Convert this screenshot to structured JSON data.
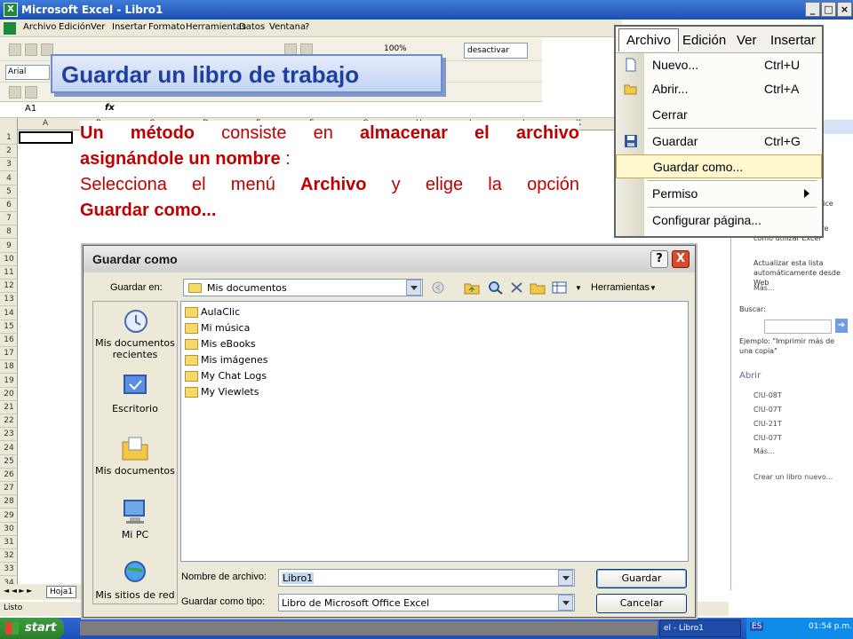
{
  "excel": {
    "title": "Microsoft Excel - Libro1",
    "menu": [
      "Archivo",
      "Edición",
      "Ver",
      "Insertar",
      "Formato",
      "Herramientas",
      "Datos",
      "Ventana",
      "?"
    ],
    "font_name": "Arial",
    "zoom": "100%",
    "desactivar": "desactivar",
    "cell_ref": "A1",
    "fx": "fx",
    "columns": [
      "A",
      "B",
      "C",
      "D",
      "E",
      "F",
      "G",
      "H",
      "I",
      "J",
      "K"
    ],
    "rows": [
      "1",
      "2",
      "3",
      "4",
      "5",
      "6",
      "7",
      "8",
      "9",
      "10",
      "11",
      "12",
      "13",
      "14",
      "15",
      "16",
      "17",
      "18",
      "19",
      "20",
      "21",
      "22",
      "23",
      "24",
      "25",
      "26",
      "27",
      "28",
      "29",
      "30",
      "31",
      "32",
      "33",
      "34"
    ],
    "sheet_tab": "Hoja1",
    "status": "Listo"
  },
  "task_pane": {
    "office_text": "ft Office",
    "help_item1": "n más reciente sobre cómo utilizar Excel",
    "help_item2": "Actualizar esta lista automáticamente desde Web",
    "mas1": "Más...",
    "search_label": "Buscar:",
    "example": "Ejemplo: \"Imprimir más de una copia\"",
    "abrir_heading": "Abrir",
    "recent_files": [
      "CIU-08T",
      "CIU-07T",
      "CIU-21T",
      "CIU-07T"
    ],
    "mas2": "Más...",
    "new_book": "Crear un libro nuevo..."
  },
  "slide": {
    "title": "Guardar un libro de trabajo",
    "line1": {
      "a": "Un método",
      "b": " consiste en ",
      "c": "almacenar el archivo"
    },
    "line2": {
      "a": "asignándole un nombre",
      "b": " :"
    },
    "line3": {
      "a": "Selecciona el menú ",
      "b": "Archivo",
      "c": " y elige la opción"
    },
    "line4": "Guardar como..."
  },
  "archivo_menu": {
    "menubar": [
      "Archivo",
      "Edición",
      "Ver",
      "Insertar"
    ],
    "items": [
      {
        "label": "Nuevo...",
        "shortcut": "Ctrl+U"
      },
      {
        "label": "Abrir...",
        "shortcut": "Ctrl+A"
      },
      {
        "label": "Cerrar",
        "shortcut": ""
      },
      {
        "label": "Guardar",
        "shortcut": "Ctrl+G"
      },
      {
        "label": "Guardar como...",
        "shortcut": "",
        "highlighted": true
      },
      {
        "label": "Permiso",
        "shortcut": ""
      },
      {
        "label": "Configurar página...",
        "shortcut": ""
      }
    ]
  },
  "dialog": {
    "title": "Guardar como",
    "help": "?",
    "close": "X",
    "save_in_label": "Guardar en:",
    "save_in_value": "Mis documentos",
    "tools_label": "Herramientas",
    "places": [
      "Mis documentos recientes",
      "Escritorio",
      "Mis documentos",
      "Mi PC",
      "Mis sitios de red"
    ],
    "files": [
      "AulaClic",
      "Mi música",
      "Mis eBooks",
      "Mis imágenes",
      "My Chat Logs",
      "My Viewlets"
    ],
    "filename_label": "Nombre de archivo:",
    "filename_value": "Libro1",
    "filetype_label": "Guardar como tipo:",
    "filetype_value": "Libro de Microsoft Office Excel",
    "save_button": "Guardar",
    "cancel_button": "Cancelar"
  },
  "taskbar": {
    "start": "start",
    "task_item": "el - Libro1",
    "lang": "ES",
    "clock": "01:54 p.m."
  },
  "colors": {
    "title_blue": "#1f3fa0",
    "red_text": "#c00000",
    "menu_highlight": "#fff8cf"
  }
}
